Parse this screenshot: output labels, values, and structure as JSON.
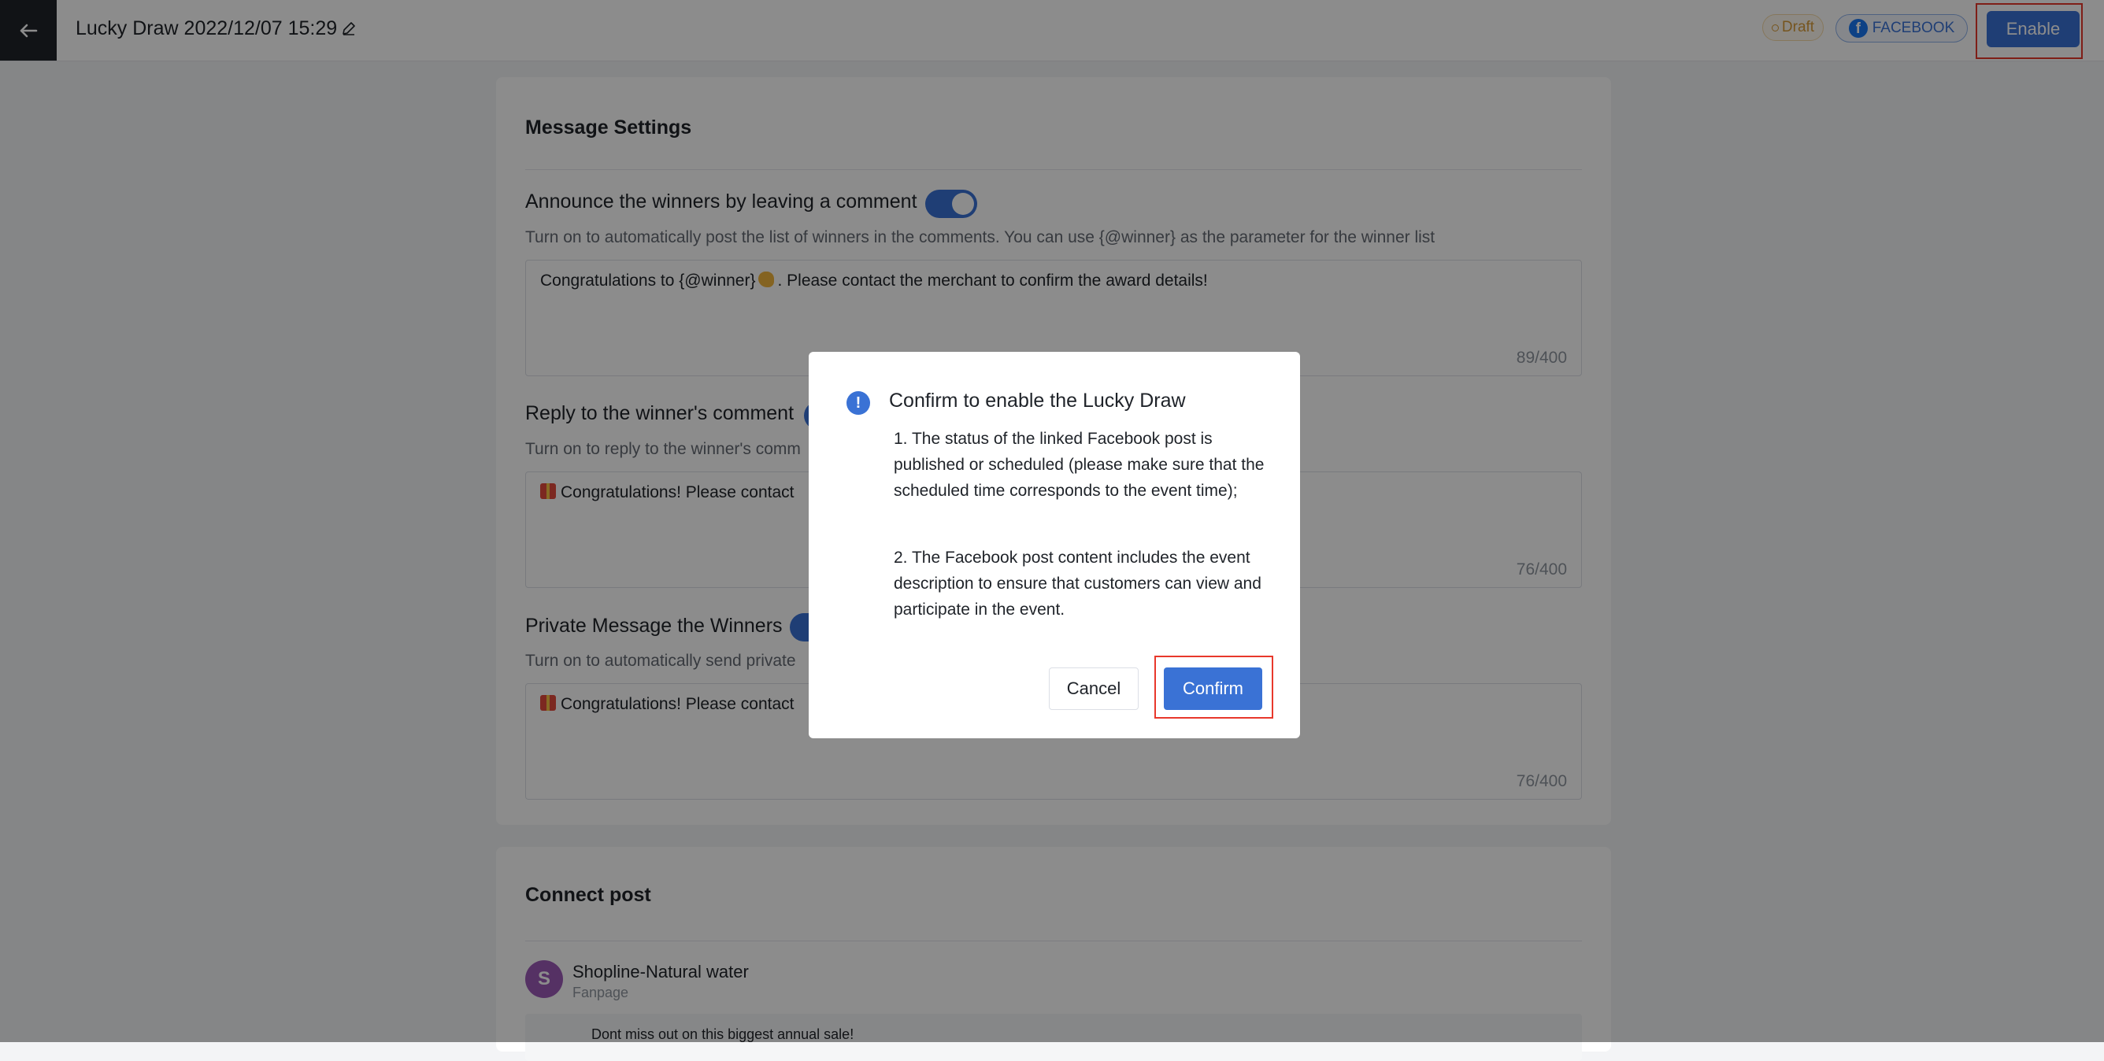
{
  "header": {
    "title": "Lucky Draw 2022/12/07 15:29",
    "status_badge": "Draft",
    "platform_badge": "FACEBOOK",
    "enable_label": "Enable"
  },
  "message_settings": {
    "title": "Message Settings",
    "announce": {
      "title": "Announce the winners by leaving a comment",
      "enabled": true,
      "description": "Turn on to automatically post the list of winners in the comments. You can use {@winner} as the parameter for the winner list",
      "text_before": "Congratulations to {@winner}",
      "text_after": ". Please contact the merchant to confirm the award details!",
      "count": "89/400"
    },
    "reply": {
      "title": "Reply to the winner's comment",
      "enabled": true,
      "description": "Turn on to reply to the winner's comm",
      "text": "Congratulations! Please contact",
      "count": "76/400"
    },
    "private_message": {
      "title": "Private Message the Winners",
      "enabled": true,
      "description": "Turn on to automatically send private",
      "text": "Congratulations! Please contact",
      "count": "76/400"
    }
  },
  "connect_post": {
    "title": "Connect post",
    "avatar_letter": "S",
    "page_name": "Shopline-Natural water",
    "page_type": "Fanpage",
    "post_text": "Dont miss out on this biggest annual sale!"
  },
  "dialog": {
    "title": "Confirm to enable the Lucky Draw",
    "item1": "1. The status of the linked Facebook post is published or scheduled (please make sure that the scheduled time corresponds to the event time);",
    "item2": "2. The Facebook post content includes the event description to ensure that customers can view and participate in the event.",
    "cancel_label": "Cancel",
    "confirm_label": "Confirm"
  },
  "colors": {
    "primary": "#3a72d5",
    "highlight": "#e8382b",
    "draft": "#d89b3a"
  }
}
